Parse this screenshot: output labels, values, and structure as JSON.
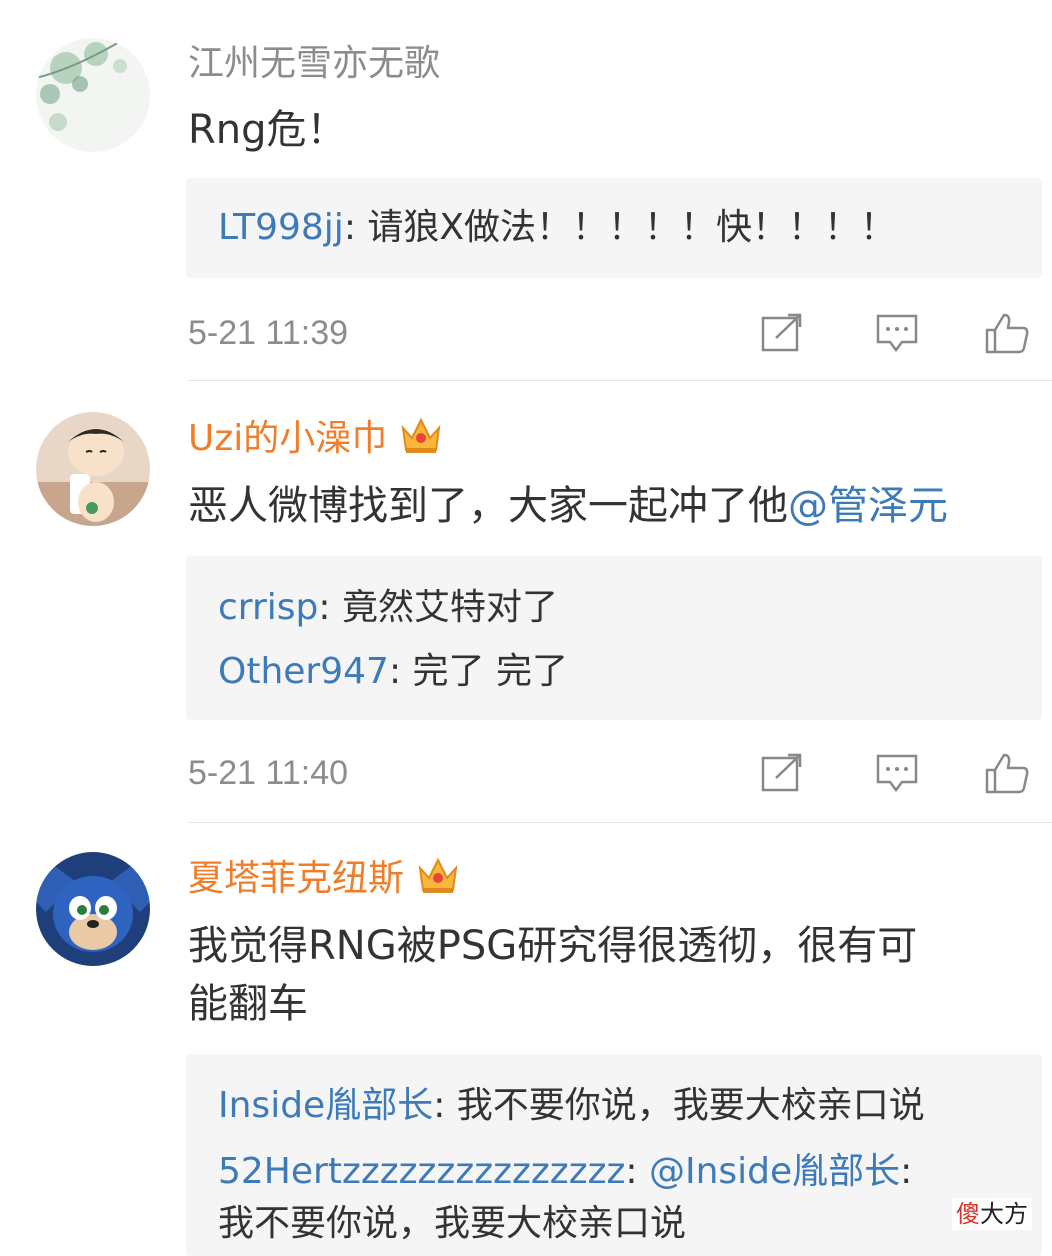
{
  "comments": [
    {
      "user": "江州无雪亦无歌",
      "text": "Rng危！",
      "replies": [
        {
          "name": "LT998jj",
          "text": "请狼X做法！！！！！快！！！！"
        }
      ],
      "time": "5-21 11:39"
    },
    {
      "user": "Uzi的小澡巾",
      "text": "恶人微博找到了，大家一起冲了他",
      "mention": "@管泽元",
      "replies": [
        {
          "name": "crrisp",
          "text": "竟然艾特对了"
        },
        {
          "name": "Other947",
          "text": "完了 完了"
        }
      ],
      "time": "5-21 11:40"
    },
    {
      "user": "夏塔菲克纽斯",
      "text_line1": "我觉得RNG被PSG研究得很透彻，很有可",
      "text_line2": "能翻车",
      "replies": [
        {
          "name": "Inside胤部长",
          "text": "我不要你说，我要大校亲口说"
        },
        {
          "name": "52Hertzzzzzzzzzzzzzzz",
          "mention": "@Inside胤部长",
          "text": "我不要你说，我要大校亲口说"
        }
      ]
    }
  ],
  "separator": ": ",
  "watermark": {
    "first": "傻",
    "rest": "大方"
  },
  "colors": {
    "link": "#3d7ab8",
    "vip_name": "#f07d2a",
    "muted": "#8c8c8c",
    "reply_bg": "#f5f5f5"
  },
  "icons": [
    "share-icon",
    "comment-icon",
    "like-icon",
    "crown-icon"
  ]
}
